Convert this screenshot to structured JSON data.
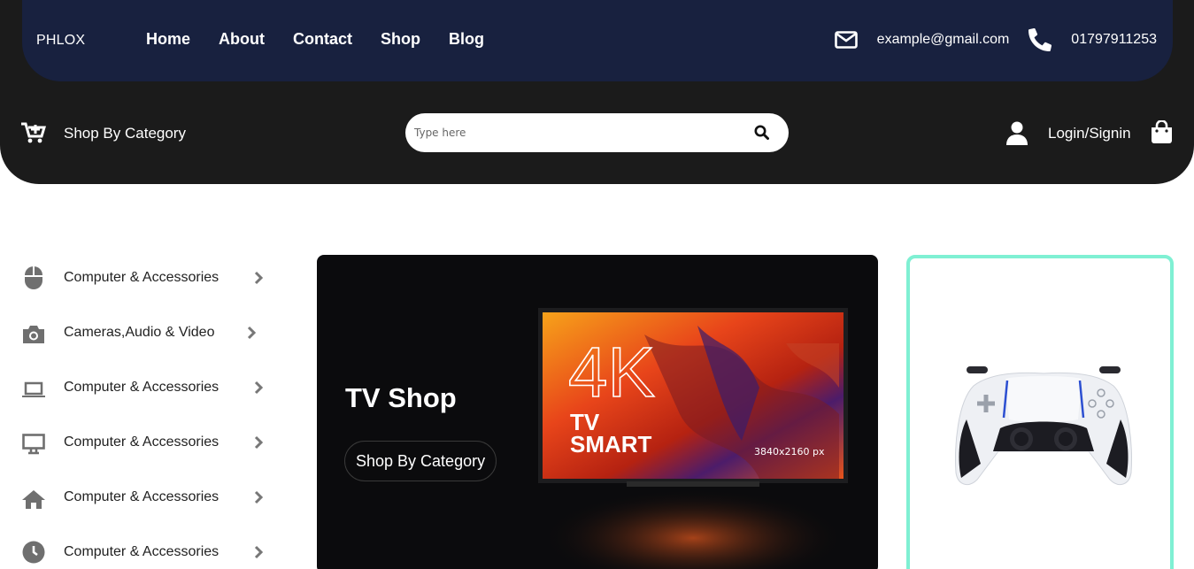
{
  "brand": "PHLOX",
  "nav": [
    "Home",
    "About",
    "Contact",
    "Shop",
    "Blog"
  ],
  "contact": {
    "email": "example@gmail.com",
    "phone": "01797911253",
    "email_icon": "envelope-icon",
    "phone_icon": "phone-icon"
  },
  "subbar": {
    "category_label": "Shop By Category",
    "cart_icon": "cart-plus-icon",
    "search_placeholder": "Type here",
    "search_icon": "search-icon",
    "user_icon": "user-icon",
    "login_label": "Login/Signin",
    "bag_icon": "shopping-bag-icon"
  },
  "categories": [
    {
      "label": "Computer & Accessories",
      "icon": "mouse-icon"
    },
    {
      "label": "Cameras,Audio & Video",
      "icon": "camera-icon"
    },
    {
      "label": "Computer & Accessories",
      "icon": "laptop-icon"
    },
    {
      "label": "Computer & Accessories",
      "icon": "desktop-icon"
    },
    {
      "label": "Computer & Accessories",
      "icon": "home-icon"
    },
    {
      "label": "Computer & Accessories",
      "icon": "clock-icon"
    }
  ],
  "hero": {
    "title": "TV Shop",
    "cta": "Shop By Category",
    "tv_text_big": "4K",
    "tv_text_line1": "TV",
    "tv_text_line2": "SMART",
    "tv_resolution": "3840x2160 px"
  },
  "card": {
    "image": "game-controller-image"
  },
  "colors": {
    "header_dark": "#1b1b1b",
    "topbar_navy": "#18213f",
    "card_border": "#7ff0d3"
  }
}
